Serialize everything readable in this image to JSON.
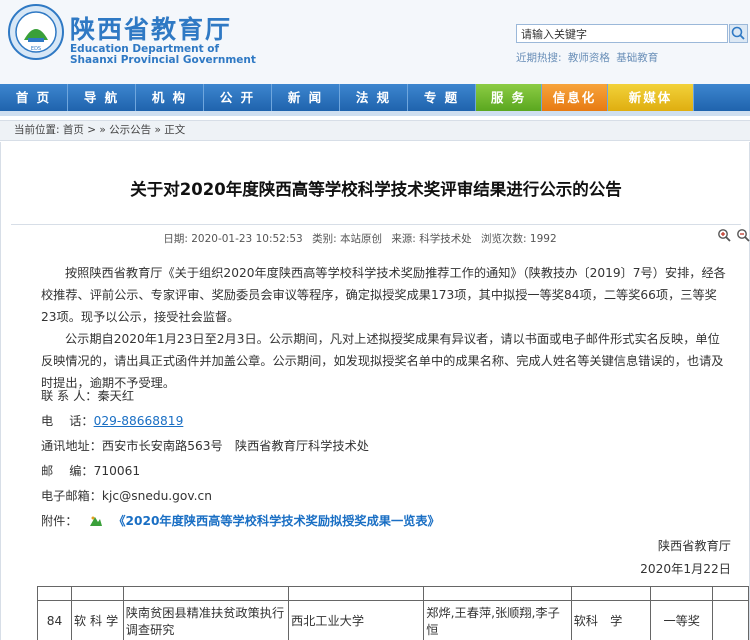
{
  "header": {
    "site_name_cn": "陕西省教育厅",
    "site_name_en_1": "Education Department of",
    "site_name_en_2": "Shaanxi Provincial Government",
    "search_placeholder": "请输入关键字",
    "hot_label": "近期热搜:",
    "hot_items": [
      "教师资格",
      "基础教育"
    ]
  },
  "nav": {
    "items": [
      "首 页",
      "导 航",
      "机 构",
      "公 开",
      "新 闻",
      "法 规",
      "专 题",
      "服 务",
      "信息化",
      "新媒体"
    ]
  },
  "breadcrumb": {
    "prefix": "当前位置:",
    "home": "首页",
    "sep1": "> » ",
    "section": "公示公告",
    "sep2": " » ",
    "current": "正文"
  },
  "article": {
    "title": "关于对2020年度陕西高等学校科学技术奖评审结果进行公示的公告",
    "meta": {
      "date": "日期: 2020-01-23 10:52:53",
      "category": "类别: 本站原创",
      "source": "来源: 科学技术处",
      "views": "浏览次数: 1992"
    },
    "paragraph1": "按照陕西省教育厅《关于组织2020年度陕西高等学校科学技术奖励推荐工作的通知》（陕教技办〔2019〕7号）安排，经各校推荐、评前公示、专家评审、奖励委员会审议等程序，确定拟授奖成果173项，其中拟授一等奖84项，二等奖66项，三等奖23项。现予以公示，接受社会监督。",
    "paragraph2": "公示期自2020年1月23日至2月3日。公示期间，凡对上述拟授奖成果有异议者，请以书面或电子邮件形式实名反映，单位反映情况的，请出具正式函件并加盖公章。公示期间，如发现拟授奖名单中的成果名称、完成人姓名等关键信息错误的，也请及时提出，逾期不予受理。",
    "contact_person": "联 系 人：秦天红",
    "phone_label": "电　 话：",
    "phone": "029-88668819",
    "address": "通讯地址：西安市长安南路563号　陕西省教育厅科学技术处",
    "postcode": "邮　 编：710061",
    "email": "电子邮箱：kjc@snedu.gov.cn",
    "attachment_label": "附件：",
    "attachment_link": "《2020年度陕西高等学校科学技术奖励拟授奖成果一览表》",
    "signature_org": "陕西省教育厅",
    "signature_date": "2020年1月22日"
  },
  "table": {
    "rows": [
      {
        "no": "84",
        "category": "软 科 学",
        "project": "陕南贫困县精准扶贫政策执行调查研究",
        "unit": "西北工业大学",
        "authors": "郑烨,王春萍,张顺翔,李子恒",
        "type": "软科　学",
        "award": "一等奖"
      }
    ]
  },
  "colors": {
    "brand_blue": "#2f79c4",
    "nav_blue": "#2a74c0",
    "nav_green": "#6bb52c",
    "nav_orange": "#ef8d22",
    "nav_yellow": "#e8c022",
    "link_blue": "#1a6fc4"
  }
}
